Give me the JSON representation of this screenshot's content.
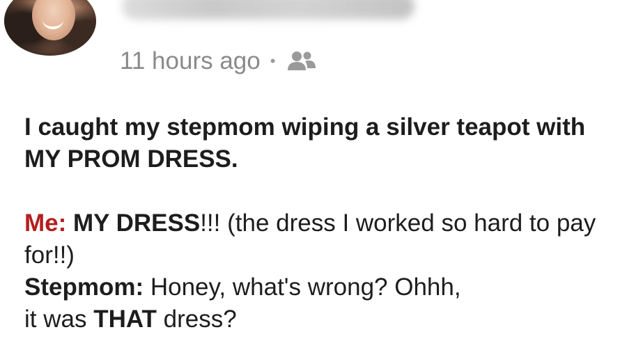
{
  "post": {
    "timestamp": "11 hours ago",
    "separator": "•",
    "audience_icon": "friends-icon",
    "headline": "I caught my stepmom wiping a silver teapot with MY PROM DRESS.",
    "me_speaker": "Me:",
    "me_exclaim": "MY DRESS",
    "me_bangs": "!!!",
    "me_rest": " (the dress I worked so hard to pay for!!)",
    "stepmom_speaker": "Stepmom:",
    "stepmom_text_1": " Honey, what's wrong? Ohhh,",
    "stepmom_text_2a": " it was ",
    "stepmom_emph": "THAT",
    "stepmom_text_2b": " dress?"
  },
  "colors": {
    "speaker_me": "#b3201e",
    "meta_text": "#8a8a8a",
    "body_text": "#1d1d1d"
  }
}
